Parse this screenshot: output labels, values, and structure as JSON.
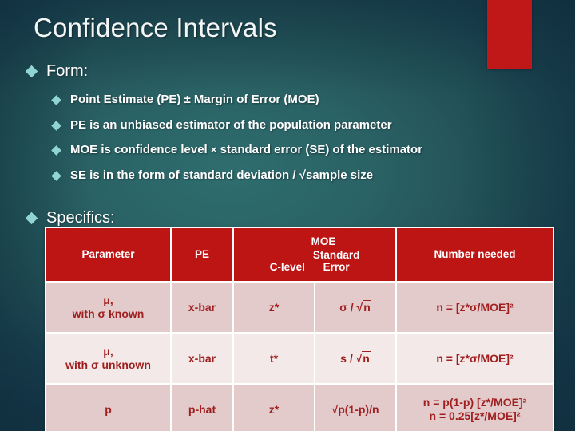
{
  "slide": {
    "title": "Confidence Intervals",
    "accent_color": "#c01718",
    "background_color": "#225157",
    "bullet_color": "#8fd5d3"
  },
  "bullets": {
    "form_label": "Form:",
    "specifics_label": "Specifics:",
    "items": [
      "Point Estimate (PE) ± Margin of Error (MOE)",
      "PE is an unbiased estimator of the population parameter",
      "MOE is confidence level × standard error (SE) of the estimator",
      "SE is in the form of standard deviation / √sample size"
    ],
    "item3_pre": "MOE is confidence level ",
    "item3_times": "×",
    "item3_post": " standard error (SE) of the estimator"
  },
  "table": {
    "headers": {
      "parameter": "Parameter",
      "pe": "PE",
      "moe_group": "MOE",
      "c_level": "C-level",
      "standard_error": "Standard Error",
      "standard_error_l1": "Standard",
      "standard_error_l2": "Error",
      "number_needed": "Number needed"
    },
    "rows": [
      {
        "parameter_l1": "μ,",
        "parameter_l2": "with σ known",
        "pe": "x-bar",
        "c_level": "z*",
        "se_prefix": "σ / √",
        "se_radicand": "n",
        "number_needed": "n = [z*σ/MOE]²",
        "number_needed_l2": ""
      },
      {
        "parameter_l1": "μ,",
        "parameter_l2": "with σ unknown",
        "pe": "x-bar",
        "c_level": "t*",
        "se_prefix": "s / √",
        "se_radicand": "n",
        "number_needed": "n = [z*σ/MOE]²",
        "number_needed_l2": ""
      },
      {
        "parameter_l1": "p",
        "parameter_l2": "",
        "pe": "p-hat",
        "c_level": "z*",
        "se_prefix": "√",
        "se_radicand": "p(1-p)/n",
        "number_needed": "n = p(1-p) [z*/MOE]²",
        "number_needed_l2": "n = 0.25[z*/MOE]²"
      }
    ]
  }
}
